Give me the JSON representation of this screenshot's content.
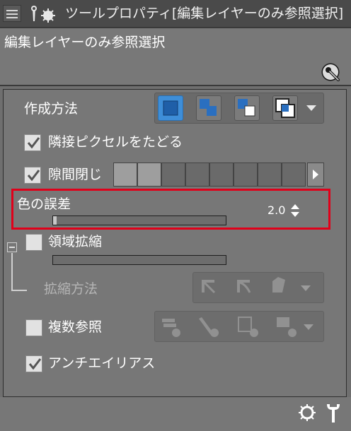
{
  "title_bar": {
    "title": "ツールプロパティ[編集レイヤーのみ参照選択]",
    "menu_icon": "panel-menu-icon",
    "tool_icon": "magic-wand-icon"
  },
  "header": {
    "tool_name": "編集レイヤーのみ参照選択",
    "settings_icon": "sub-tool-settings-icon"
  },
  "properties": {
    "creation_method": {
      "label": "作成方法",
      "options": [
        "new-selection",
        "add-selection",
        "subtract-selection",
        "intersect-selection"
      ],
      "selected": "new-selection"
    },
    "trace_adjacent": {
      "label": "隣接ピクセルをたどる",
      "checked": true
    },
    "gap_closing": {
      "label": "隙間閉じ",
      "checked": true,
      "levels": 8,
      "active_level": 2
    },
    "color_margin": {
      "label": "色の誤差",
      "value": "2.0",
      "fraction": 0.02
    },
    "area_scaling": {
      "label": "領域拡縮",
      "checked": false,
      "method_label": "拡縮方法"
    },
    "multiple_referring": {
      "label": "複数参照",
      "checked": false
    },
    "antialiasing": {
      "label": "アンチエイリアス",
      "checked": true
    }
  },
  "footer": {
    "icons": [
      "initial-settings-icon",
      "sub-tool-detail-icon"
    ]
  },
  "colors": {
    "accent": "#3e8ed8",
    "highlight": "#e0001a"
  }
}
